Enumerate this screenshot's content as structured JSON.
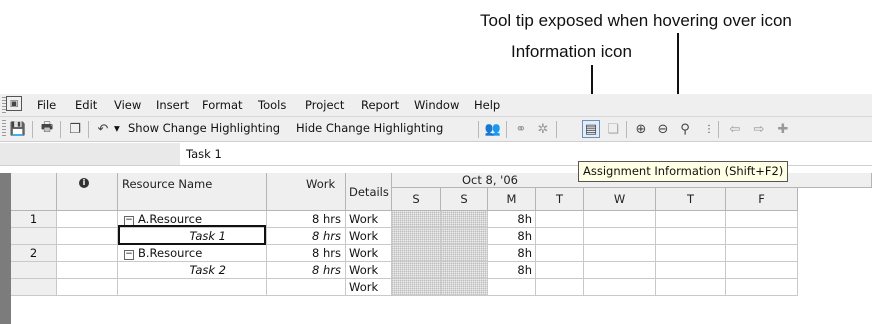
{
  "annotations": {
    "tooltip_callout": "Tool tip exposed when hovering over icon",
    "icon_callout": "Information icon"
  },
  "menu": [
    "File",
    "Edit",
    "View",
    "Insert",
    "Format",
    "Tools",
    "Project",
    "Report",
    "Window",
    "Help"
  ],
  "toolbar": {
    "show_highlighting": "Show Change Highlighting",
    "hide_highlighting": "Hide Change Highlighting",
    "dropdown_glyph": "▾"
  },
  "entry_bar": {
    "value": "Task 1"
  },
  "tooltip": {
    "text": "Assignment Information (Shift+F2)"
  },
  "table": {
    "headers": {
      "id": "",
      "indicator": "i",
      "name": "Resource Name",
      "work": "Work",
      "details": "Details"
    },
    "timescale": {
      "week": "Oct 8, '06",
      "days": [
        "S",
        "S",
        "M",
        "T",
        "W",
        "T",
        "F"
      ]
    },
    "rows": [
      {
        "id": "1",
        "name": "A.Resource",
        "expand": "−",
        "work": "8 hrs",
        "detail": "Work",
        "values": [
          "",
          "",
          "8h",
          "",
          "",
          "",
          ""
        ]
      },
      {
        "id": "",
        "name": "Task 1",
        "expand": "",
        "work": "8 hrs",
        "detail": "Work",
        "values": [
          "",
          "",
          "8h",
          "",
          "",
          "",
          ""
        ]
      },
      {
        "id": "2",
        "name": "B.Resource",
        "expand": "−",
        "work": "8 hrs",
        "detail": "Work",
        "values": [
          "",
          "",
          "8h",
          "",
          "",
          "",
          ""
        ]
      },
      {
        "id": "",
        "name": "Task 2",
        "expand": "",
        "work": "8 hrs",
        "detail": "Work",
        "values": [
          "",
          "",
          "8h",
          "",
          "",
          "",
          ""
        ]
      },
      {
        "id": "",
        "name": "",
        "expand": "",
        "work": "",
        "detail": "Work",
        "values": [
          "",
          "",
          "",
          "",
          "",
          "",
          ""
        ]
      }
    ]
  }
}
